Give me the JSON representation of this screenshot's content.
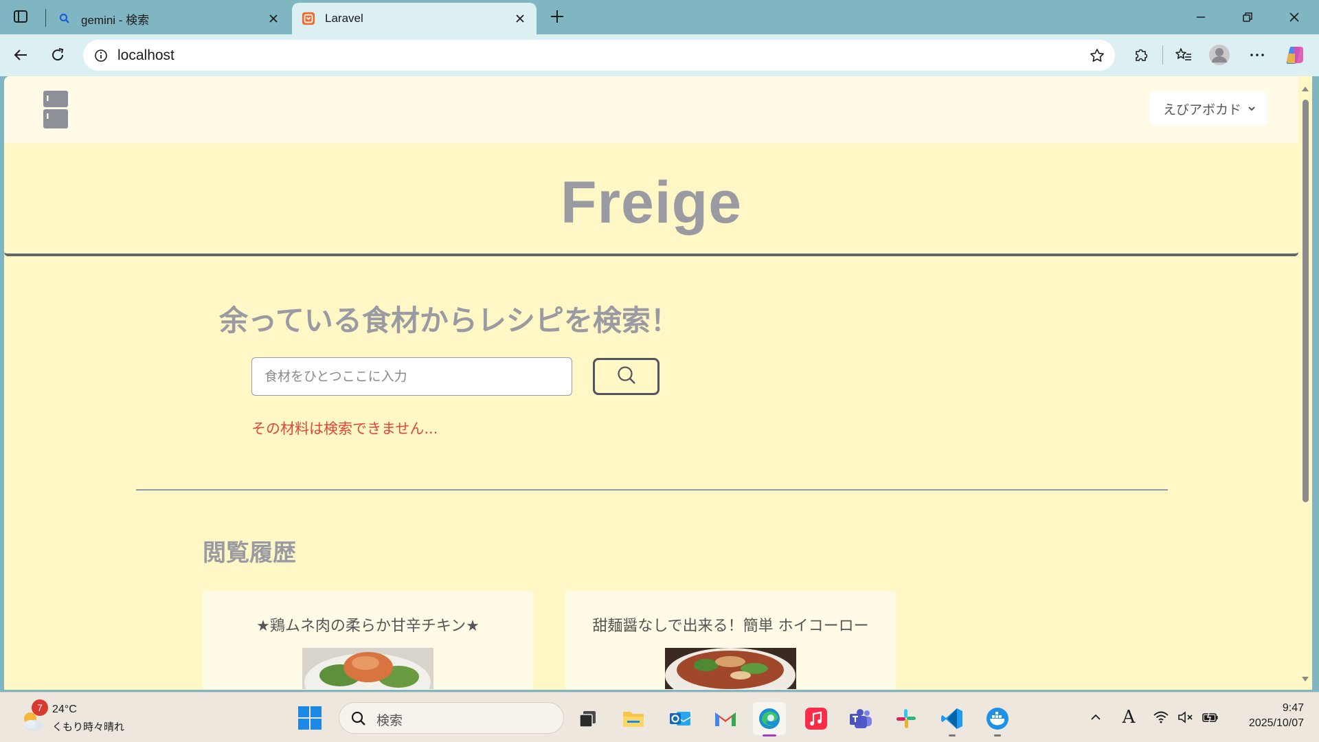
{
  "browser": {
    "tabs": [
      {
        "title": "gemini - 検索",
        "favicon": "search-icon",
        "active": false
      },
      {
        "title": "Laravel",
        "favicon": "laravel-icon",
        "active": true
      }
    ],
    "address": "localhost"
  },
  "page": {
    "user_menu": "えびアボカド",
    "brand": "Freige",
    "search": {
      "heading": "余っている食材からレシピを検索！",
      "placeholder": "食材をひとつここに入力",
      "value": "",
      "error": "その材料は検索できません..."
    },
    "history": {
      "heading": "閲覧履歴",
      "recipes": [
        {
          "title": "★鶏ムネ肉の柔らか甘辛チキン★"
        },
        {
          "title": "甜麺醤なしで出来る！簡単 ホイコーロー"
        }
      ]
    }
  },
  "taskbar": {
    "weather": {
      "temp": "24°C",
      "condition": "くもり時々晴れ",
      "badge": "7"
    },
    "search_label": "検索",
    "clock": {
      "time": "9:47",
      "date": "2025/10/07"
    },
    "ime": "A"
  },
  "colors": {
    "page_bg": "#fff7c5",
    "nav_bg": "#fffbe6",
    "brand_text": "#9a9aa2",
    "error": "#e2463a",
    "browser_frame": "#7fb6c2"
  }
}
